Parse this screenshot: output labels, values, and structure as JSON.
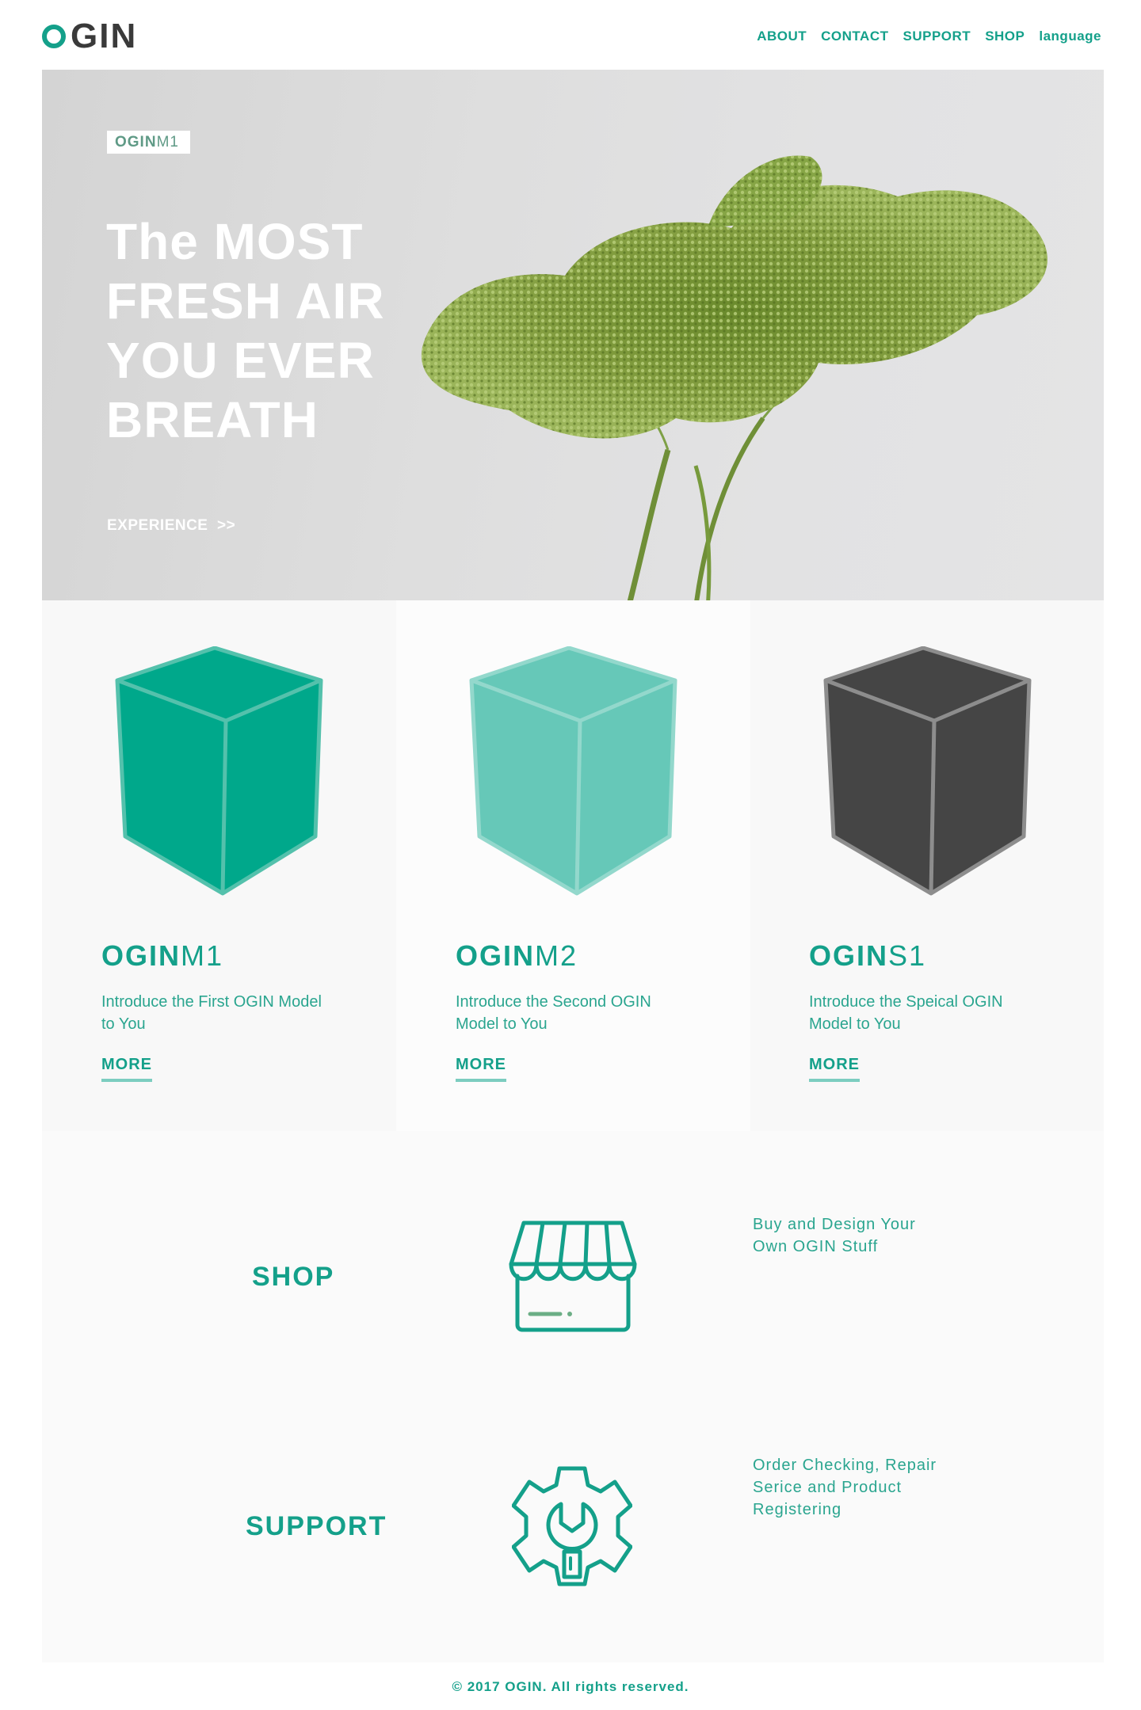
{
  "header": {
    "logo_text": "GIN",
    "nav": [
      "ABOUT",
      "CONTACT",
      "SUPPORT",
      "SHOP",
      "language"
    ]
  },
  "hero": {
    "badge_bold": "OGIN",
    "badge_light": "M1",
    "title": "The MOST FRESH AIR YOU EVER BREATH",
    "cta": "EXPERIENCE  >>"
  },
  "products": [
    {
      "name_bold": "OGIN",
      "name_light": "M1",
      "desc": "Introduce the First OGIN Model to You",
      "more": "MORE",
      "color": "#00a88b"
    },
    {
      "name_bold": "OGIN",
      "name_light": "M2",
      "desc": "Introduce the Second OGIN Model to You",
      "more": "MORE",
      "color": "#66c8b8"
    },
    {
      "name_bold": "OGIN",
      "name_light": "S1",
      "desc": "Introduce the Speical OGIN Model to You",
      "more": "MORE",
      "color": "#454545"
    }
  ],
  "services": [
    {
      "title": "SHOP",
      "icon": "storefront-icon",
      "desc": "Buy and Design Your Own OGIN Stuff"
    },
    {
      "title": "SUPPORT",
      "icon": "gear-wrench-icon",
      "desc": "Order Checking, Repair Serice and Product Registering"
    }
  ],
  "footer": {
    "text": "© 2017 OGIN. All rights reserved."
  },
  "colors": {
    "accent": "#14a08a",
    "dark": "#3a3a3a"
  }
}
